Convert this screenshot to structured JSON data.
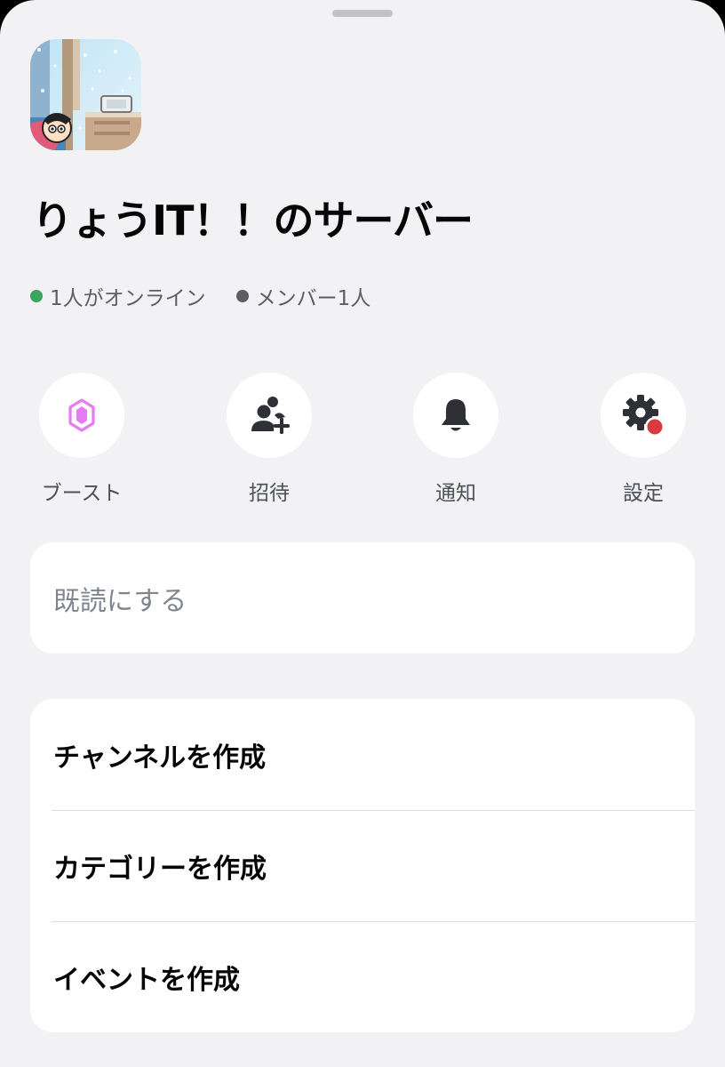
{
  "server": {
    "name": "りょうIT！！のサーバー",
    "online": "1人がオンライン",
    "members": "メンバー1人"
  },
  "colors": {
    "online_dot": "#3ba55c",
    "members_dot": "#5c5e66",
    "boost_icon": "#e57cf3",
    "settings_badge": "#d83c3e",
    "icon_dark": "#2e3035"
  },
  "actions": [
    {
      "label": "ブースト",
      "icon": "boost-gem-icon"
    },
    {
      "label": "招待",
      "icon": "invite-people-icon"
    },
    {
      "label": "通知",
      "icon": "bell-icon"
    },
    {
      "label": "設定",
      "icon": "gear-icon"
    }
  ],
  "read_card": {
    "mark_read": "既読にする"
  },
  "create_card": {
    "items": [
      {
        "label": "チャンネルを作成"
      },
      {
        "label": "カテゴリーを作成"
      },
      {
        "label": "イベントを作成"
      }
    ]
  }
}
